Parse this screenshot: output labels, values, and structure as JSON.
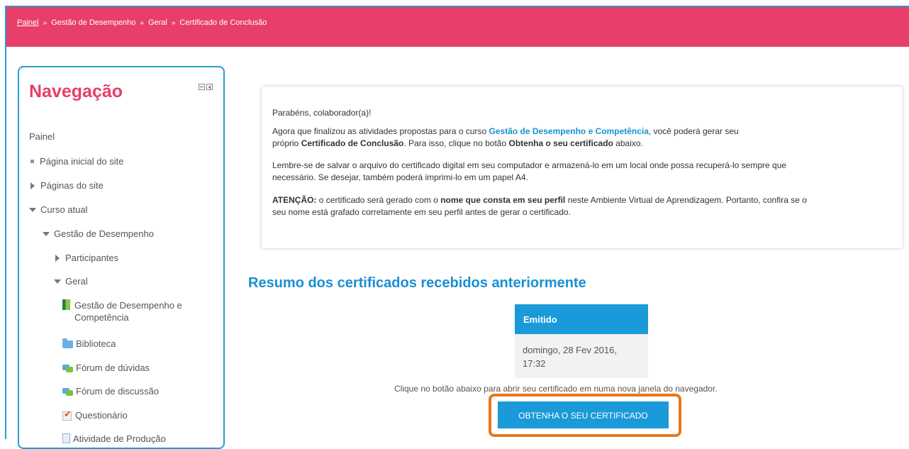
{
  "breadcrumb": {
    "home": "Painel",
    "items": [
      "Gestão de Desempenho",
      "Geral",
      "Certificado de Conclusão"
    ],
    "separator": "»"
  },
  "navigation": {
    "title": "Navegação",
    "items": [
      {
        "label": "Painel"
      },
      {
        "label": "Página inicial do site"
      },
      {
        "label": "Páginas do site"
      },
      {
        "label": "Curso atual"
      },
      {
        "label": "Gestão de Desempenho"
      },
      {
        "label": "Participantes"
      },
      {
        "label": "Geral"
      },
      {
        "label": "Gestão de Desempenho e Competência",
        "icon": "book-icon"
      },
      {
        "label": "Biblioteca",
        "icon": "folder-icon"
      },
      {
        "label": "Fórum de dúvidas",
        "icon": "forum-icon"
      },
      {
        "label": "Fórum de discussão",
        "icon": "forum-icon"
      },
      {
        "label": "Questionário",
        "icon": "quiz-icon"
      },
      {
        "label": "Atividade de Produção",
        "icon": "page-icon"
      }
    ]
  },
  "notice": {
    "greeting": "Parabéns, colaborador(a)!",
    "p1_a": "Agora que finalizou as atividades propostas para o curso ",
    "p1_course": "Gestão de Desempenho e Competência",
    "p1_b": ", você poderá gerar seu",
    "p1_c": "próprio ",
    "p1_cert": "Certificado de Conclusão",
    "p1_d": ". Para isso, clique no botão ",
    "p1_btn": "Obtenha o seu certificado",
    "p1_e": " abaixo.",
    "p2_line1": "Lembre-se de salvar o arquivo do certificado digital em seu computador e armazená-lo em um local onde possa recuperá-lo sempre que",
    "p2_line2": "necessário. Se desejar, também poderá imprimi-lo em um papel A4.",
    "p3_label": "ATENÇÃO:",
    "p3_a": " o certificado será gerado com o ",
    "p3_bold": "nome que consta em seu perfil",
    "p3_b": " neste Ambiente Virtual de Aprendizagem. Portanto, confira se o",
    "p3_line2": "seu nome está grafado corretamente em seu perfil antes de gerar o certificado."
  },
  "summary": {
    "title": "Resumo dos certificados recebidos anteriormente",
    "column_header": "Emitido",
    "issued_line1": "domingo, 28 Fev 2016,",
    "issued_line2": "17:32"
  },
  "instruction": "Clique no botão abaixo para abrir seu certificado em numa nova janela do navegador.",
  "button_label": "OBTENHA O SEU CERTIFICADO",
  "colors": {
    "brand_pink": "#e83e6a",
    "accent_blue": "#1a9ad9",
    "highlight_orange": "#e8781a"
  }
}
